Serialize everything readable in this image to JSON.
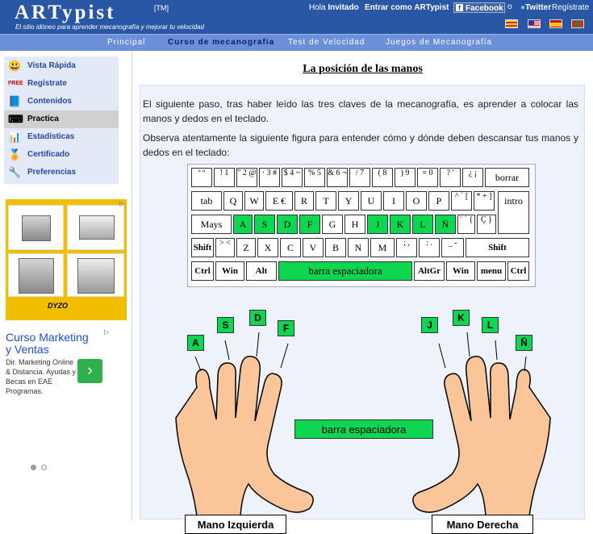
{
  "header": {
    "logo": "ARTypist",
    "tm": "[TM]",
    "tagline": "El sitio idóneo para aprender mecanografía y mejorar tu velocidad",
    "hola": "Hola",
    "user": "Invitado",
    "login": "Entrar como ARTypist",
    "facebook": "Facebook",
    "or": "o",
    "twitter": "Twitter",
    "register": "Regístrate"
  },
  "nav": [
    "Principal",
    "Curso de mecanografía",
    "Test de Velocidad",
    "Juegos de Mecanografía"
  ],
  "sidebar": {
    "items": [
      {
        "label": "Vista Rápida",
        "icon": "smiley-icon"
      },
      {
        "label": "Regístrate",
        "icon": "free-icon"
      },
      {
        "label": "Contenidos",
        "icon": "book-icon"
      },
      {
        "label": "Practica",
        "icon": "keyboard-icon"
      },
      {
        "label": "Estadísticas",
        "icon": "chart-icon"
      },
      {
        "label": "Certificado",
        "icon": "certificate-icon"
      },
      {
        "label": "Preferencias",
        "icon": "tools-icon"
      }
    ],
    "ad1_brand": "DYZO",
    "ad2": {
      "title": "Curso Marketing y Ventas",
      "desc": "Dir. Marketing Online & Distancia. Ayudas y Becas en EAE Programas.",
      "arrow": "›"
    }
  },
  "main": {
    "title": "La posición de las manos",
    "para1": "El siguiente paso, tras haber leído las tres claves de la mecanografía, es aprender a colocar las manos y dedos en el teclado.",
    "para2": "Observa atentamente la siguiente figura para entender cómo y dónde deben descansar tus manos y dedos en el teclado:",
    "space_label": "barra espaciadora",
    "left_hand": "Mano Izquierda",
    "right_hand": "Mano Derecha",
    "left_keys": [
      "A",
      "S",
      "D",
      "F"
    ],
    "right_keys": [
      "J",
      "K",
      "L",
      "Ñ"
    ]
  },
  "keyboard": {
    "row1": [
      "ª º",
      "! 1",
      "\" 2 @",
      "· 3 #",
      "$ 4 ~",
      "% 5",
      "& 6 ¬",
      "/ 7",
      "( 8",
      ") 9",
      "= 0",
      "? '",
      "¿ ¡",
      "borrar"
    ],
    "row2": [
      "tab",
      "Q",
      "W",
      "E €",
      "R",
      "T",
      "Y",
      "U",
      "I",
      "O",
      "P",
      "^ ` [",
      "* + ]",
      "intro"
    ],
    "row3": [
      "Mays",
      "A",
      "S",
      "D",
      "F",
      "G",
      "H",
      "J",
      "K",
      "L",
      "Ñ",
      "¨ ´ {",
      "Ç }"
    ],
    "row4": [
      "Shift",
      "> <",
      "Z",
      "X",
      "C",
      "V",
      "B",
      "N",
      "M",
      "; ,",
      ": .",
      "_ -",
      "Shift"
    ],
    "row5": [
      "Ctrl",
      "Win",
      "Alt",
      "barra espaciadora",
      "AltGr",
      "Win",
      "menu",
      "Ctrl"
    ]
  },
  "colors": {
    "header_bg": "#2a56a6",
    "nav_bg": "#6b8fd8",
    "home_key_green": "#0fd650",
    "content_bg": "#eef2fa",
    "skin": "#fbc59a"
  }
}
